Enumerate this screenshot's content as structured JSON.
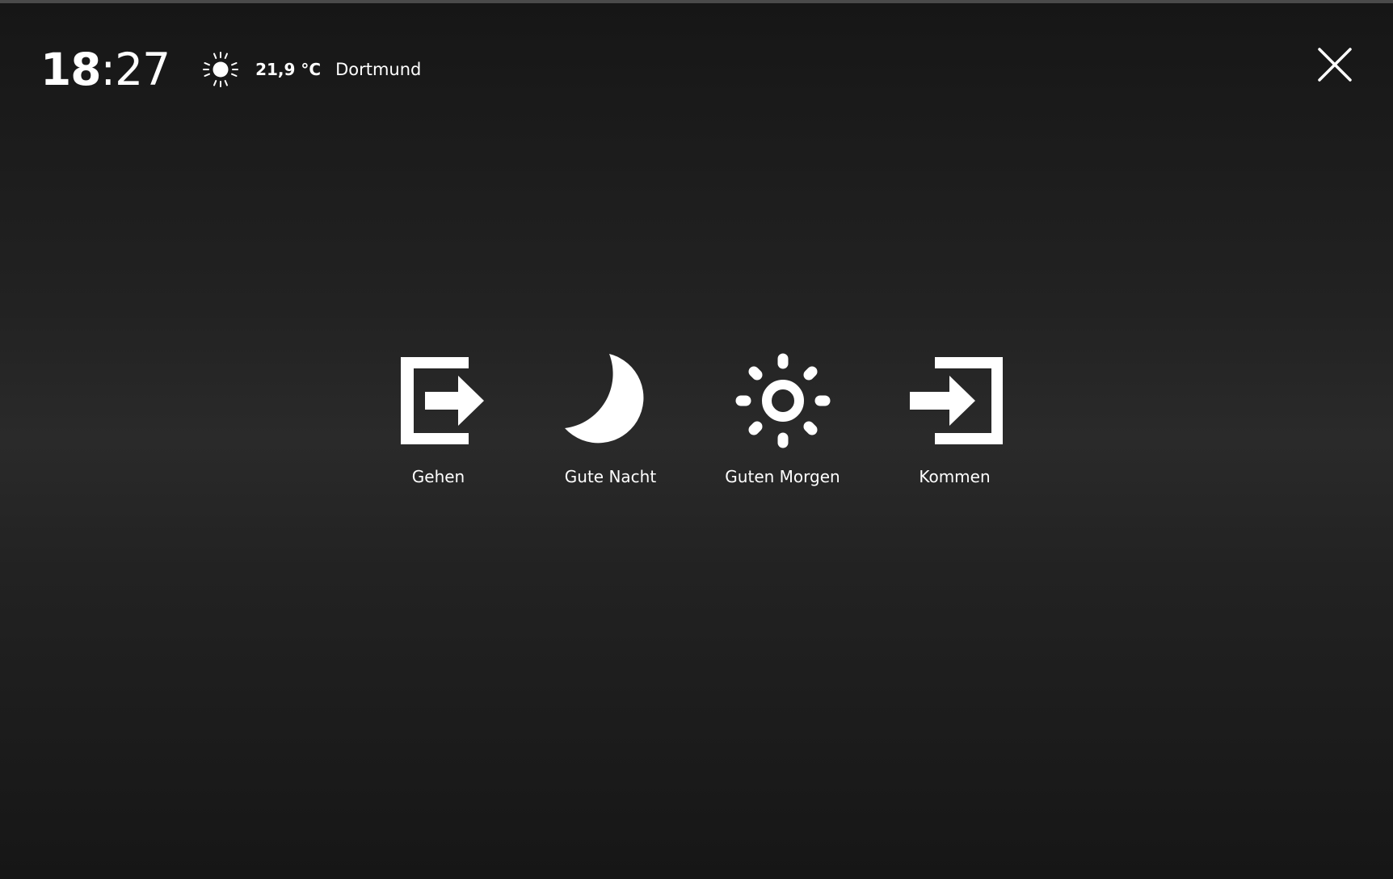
{
  "status": {
    "clock_hours": "18",
    "clock_separator": ":",
    "clock_minutes": "27",
    "weather_icon": "sun-icon",
    "temperature": "21,9 °C",
    "city": "Dortmund"
  },
  "close": {
    "icon": "close-icon"
  },
  "scenes": [
    {
      "label": "Gehen",
      "icon": "exit-icon"
    },
    {
      "label": "Gute Nacht",
      "icon": "moon-icon"
    },
    {
      "label": "Guten Morgen",
      "icon": "sun-icon"
    },
    {
      "label": "Kommen",
      "icon": "enter-icon"
    }
  ],
  "colors": {
    "foreground": "#ffffff",
    "background": "#222222"
  }
}
